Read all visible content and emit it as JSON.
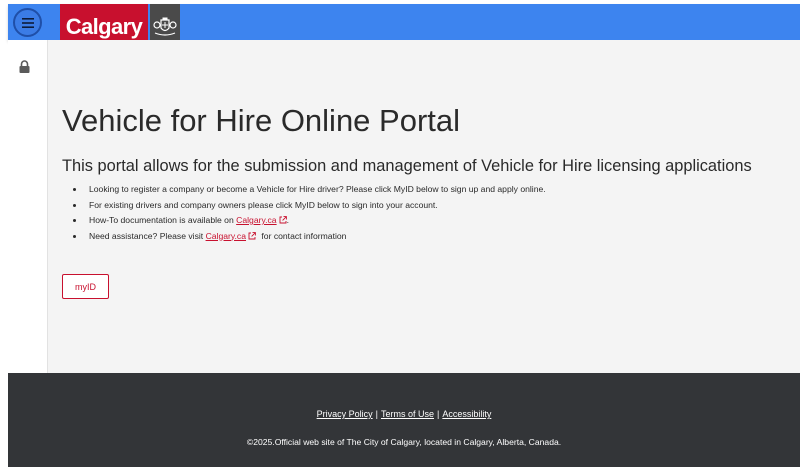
{
  "header": {
    "logo_text": "Calgary",
    "menu_icon": "hamburger-menu-icon",
    "crest_icon": "city-crest-icon"
  },
  "sidebar": {
    "icon": "lock-icon"
  },
  "main": {
    "title": "Vehicle for Hire Online Portal",
    "subtitle": "This portal allows for the submission and management of Vehicle for Hire licensing applications",
    "bullets": [
      {
        "text": "Looking to register a company or become a Vehicle for Hire driver? Please click MyID below to sign up and apply online."
      },
      {
        "text": "For existing drivers and company owners please click MyID below to sign into your account."
      },
      {
        "before": "How-To documentation is available on ",
        "link": "Calgary.ca",
        "after": "."
      },
      {
        "before": "Need assistance? Please visit ",
        "link": "Calgary.ca",
        "after": " for contact information"
      }
    ],
    "myid_label": "myID"
  },
  "footer": {
    "links": [
      "Privacy Policy",
      "Terms of Use",
      "Accessibility"
    ],
    "separator": "|",
    "copyright": "©2025.Official web site of The City of Calgary, located in Calgary, Alberta, Canada."
  },
  "colors": {
    "brand_red": "#c8102e",
    "header_blue": "#3d84ef",
    "footer_dark": "#333538",
    "crest_gray": "#4a4a4a"
  }
}
